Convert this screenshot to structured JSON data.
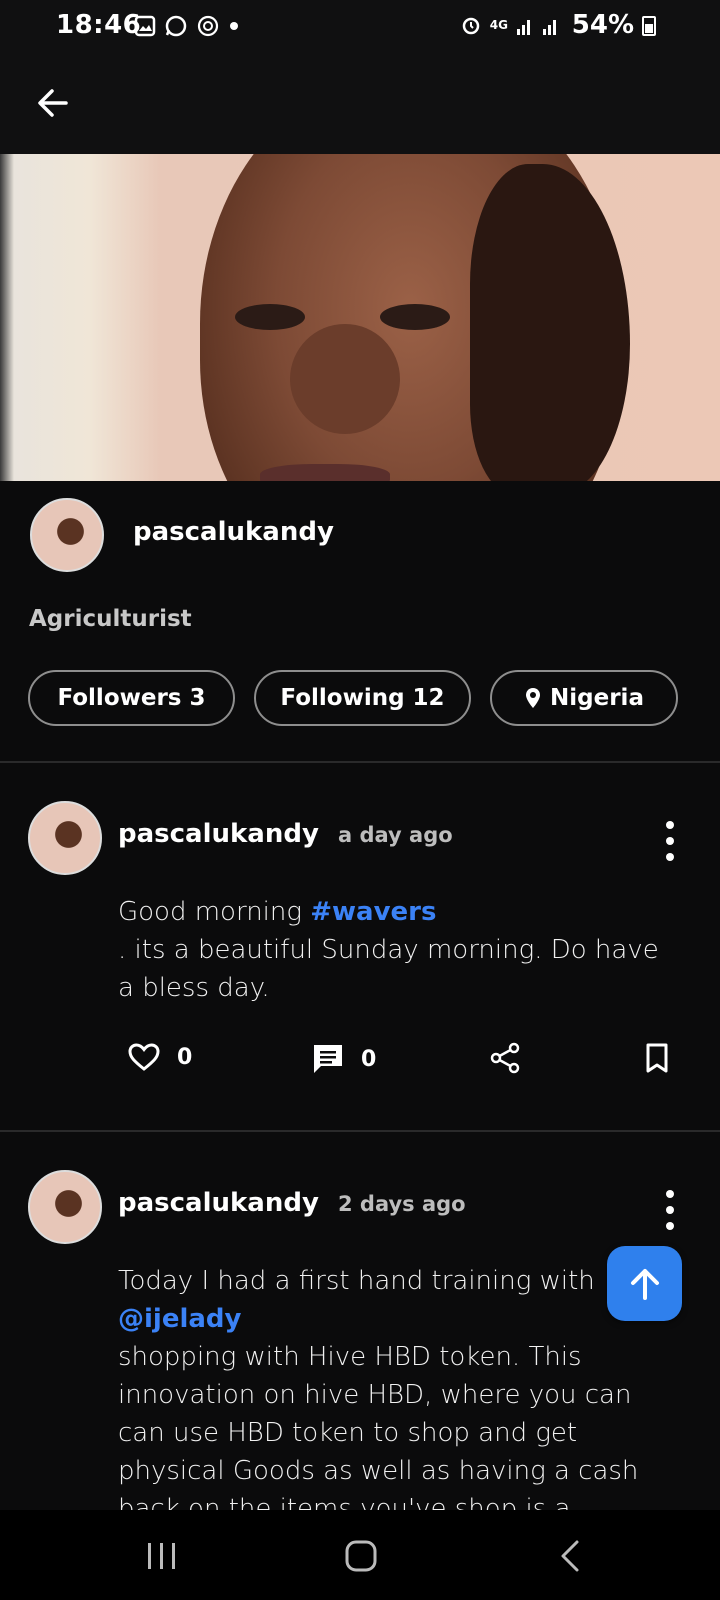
{
  "status_bar": {
    "time": "18:46",
    "battery": "54%",
    "network": "4G"
  },
  "profile": {
    "username": "pascalukandy",
    "bio": "Agriculturist",
    "followers_label": "Followers 3",
    "following_label": "Following 12",
    "location": "Nigeria"
  },
  "posts": [
    {
      "author": "pascalukandy",
      "time": "a day ago",
      "text_before": "Good morning ",
      "tag": "#wavers",
      "text_after": ". its a beautiful Sunday morning. Do have a bless day.",
      "likes": "0",
      "comments": "0"
    },
    {
      "author": "pascalukandy",
      "time": "2 days ago",
      "text_before": "Today I had a first hand training with ",
      "mention": "@ijelady",
      "text_after": " shopping with Hive  HBD token. This innovation on hive HBD, where you can can use HBD token to shop and get physical Goods as well as having a cash back on the items you've shop is a"
    }
  ],
  "icons": {
    "back": "arrow-left-icon",
    "location": "location-pin-icon",
    "more": "more-vertical-icon",
    "like": "heart-icon",
    "comment": "comment-icon",
    "share": "share-icon",
    "bookmark": "bookmark-icon",
    "scroll_top": "arrow-up-icon"
  },
  "colors": {
    "background": "#0b0b0c",
    "accent": "#2f80ed",
    "link": "#3b82f6"
  }
}
